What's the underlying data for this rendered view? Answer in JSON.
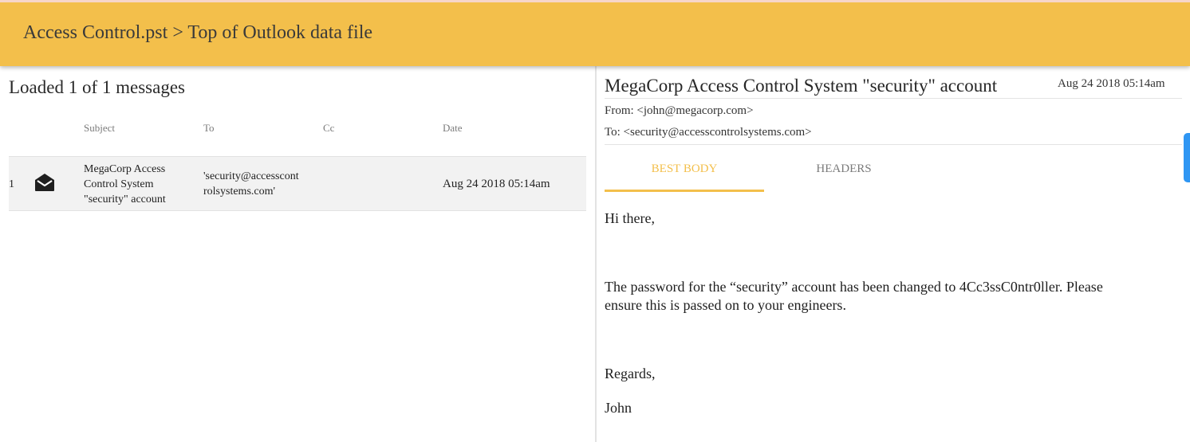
{
  "header": {
    "breadcrumb": "Access Control.pst > Top of Outlook data file",
    "accent_color": "#f3bf4b"
  },
  "message_list": {
    "status": "Loaded 1 of 1 messages",
    "columns": [
      "Subject",
      "To",
      "Cc",
      "Date"
    ],
    "rows": [
      {
        "index": "1",
        "icon": "envelope-open-icon",
        "subject_lines": [
          "MegaCorp Access",
          "Control System",
          "\"security\" account"
        ],
        "to_lines": [
          "'security@accesscont",
          "rolsystems.com'"
        ],
        "cc": "",
        "date": "Aug 24 2018 05:14am"
      }
    ]
  },
  "message": {
    "subject": "MegaCorp Access Control System \"security\" account",
    "date": "Aug 24 2018 05:14am",
    "from": "From: <john@megacorp.com>",
    "to": "To: <security@accesscontrolsystems.com>",
    "tabs": [
      {
        "label": "BEST BODY",
        "active": true
      },
      {
        "label": "HEADERS",
        "active": false
      }
    ],
    "body": [
      "Hi there,",
      "The password for the “security” account has been changed to 4Cc3ssC0ntr0ller.  Please",
      "ensure this is passed on to your engineers.",
      "Regards,",
      "John"
    ]
  }
}
